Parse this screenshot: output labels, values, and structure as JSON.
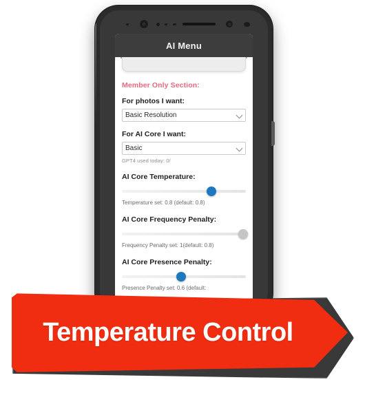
{
  "phone": {
    "icons": {
      "camera": "camera-icon",
      "speaker": "speaker-grille-icon",
      "proximity_sensor": "proximity-sensor-icon",
      "ir_sensor": "infrared-sensor-icon",
      "power_button": "power-button"
    }
  },
  "app": {
    "title": "AI Menu",
    "accent_color": "#6ea8dc",
    "titlebar_color": "#3d3d3d"
  },
  "form": {
    "member_section_heading": "Member Only Section:",
    "member_section_color": "#e8697e",
    "photos": {
      "label": "For photos I want:",
      "value": "Basic Resolution",
      "placeholder": "Basic Resolution"
    },
    "ai_core": {
      "label": "For AI Core I want:",
      "value": "Basic",
      "placeholder": "Basic"
    },
    "usage_note": "GPT4 used today: 0/",
    "sliders": [
      {
        "label": "AI Core Temperature:",
        "value_percent": 72,
        "thumb_color": "#1d78bf",
        "note": "Temperature set: 0.8 (default: 0.8)"
      },
      {
        "label": "AI Core Frequency Penalty:",
        "value_percent": 98,
        "thumb_color": "#c5c5c5",
        "note": "Frequency Penalty set: 1(default: 0.8)"
      },
      {
        "label": "AI Core Presence Penalty:",
        "value_percent": 48,
        "thumb_color": "#1d78bf",
        "note": "Presence Penalty set: 0.6 (default:"
      }
    ]
  },
  "banner": {
    "label": "Temperature Control",
    "color": "#f02d11",
    "text_color": "#ffffff"
  }
}
